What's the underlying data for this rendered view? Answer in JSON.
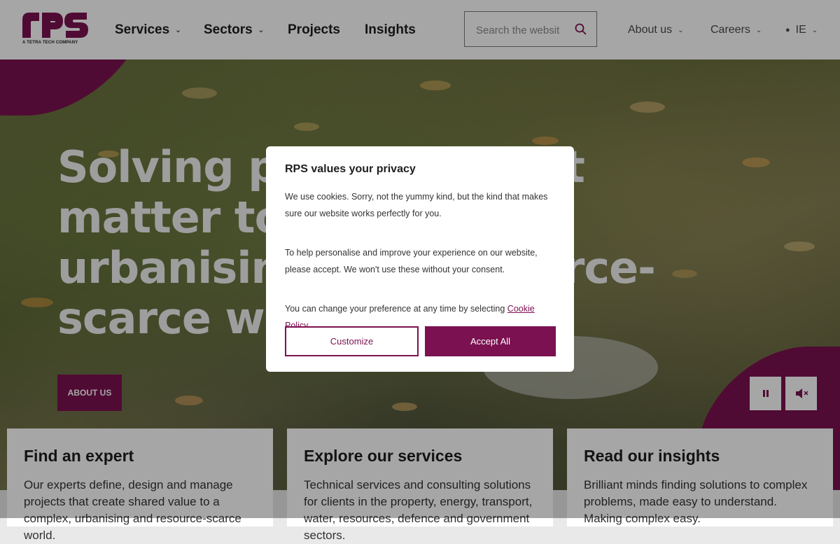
{
  "header": {
    "logo_text": "rps",
    "logo_tagline": "A TETRA TECH COMPANY",
    "nav": [
      {
        "label": "Services",
        "has_dropdown": true
      },
      {
        "label": "Sectors",
        "has_dropdown": true
      },
      {
        "label": "Projects",
        "has_dropdown": false
      },
      {
        "label": "Insights",
        "has_dropdown": false
      }
    ],
    "search": {
      "placeholder": "Search the website"
    },
    "utility": [
      {
        "label": "About us"
      },
      {
        "label": "Careers"
      },
      {
        "label": "IE"
      }
    ]
  },
  "hero": {
    "title": "Solving problems that matter to a complex, urbanising and resource-scarce world",
    "cta_label": "ABOUT US",
    "pause_icon": "pause-icon",
    "mute_icon": "mute-icon"
  },
  "cards": [
    {
      "title": "Find an expert",
      "text": "Our experts define, design and manage projects that create shared value to a complex, urbanising and resource-scarce world."
    },
    {
      "title": "Explore our services",
      "text": "Technical services and consulting solutions for clients in the property, energy, transport, water, resources, defence and government sectors."
    },
    {
      "title": "Read our insights",
      "text": "Brilliant minds finding solutions to complex problems, made easy to understand. Making complex easy."
    }
  ],
  "consent": {
    "title": "RPS values your privacy",
    "paragraph1": "We use cookies. Sorry, not the yummy kind, but the kind that makes sure our website works perfectly for you.",
    "paragraph2": "To help personalise and improve your experience on our website, please accept. We won't use these without your consent.",
    "paragraph3_prefix": "You can change your preference at any time by selecting ",
    "policy_link": "Cookie Policy",
    "customize_label": "Customize",
    "accept_label": "Accept All"
  },
  "colors": {
    "brand": "#7b1150",
    "overlay": "rgba(0,0,0,0.35)"
  }
}
